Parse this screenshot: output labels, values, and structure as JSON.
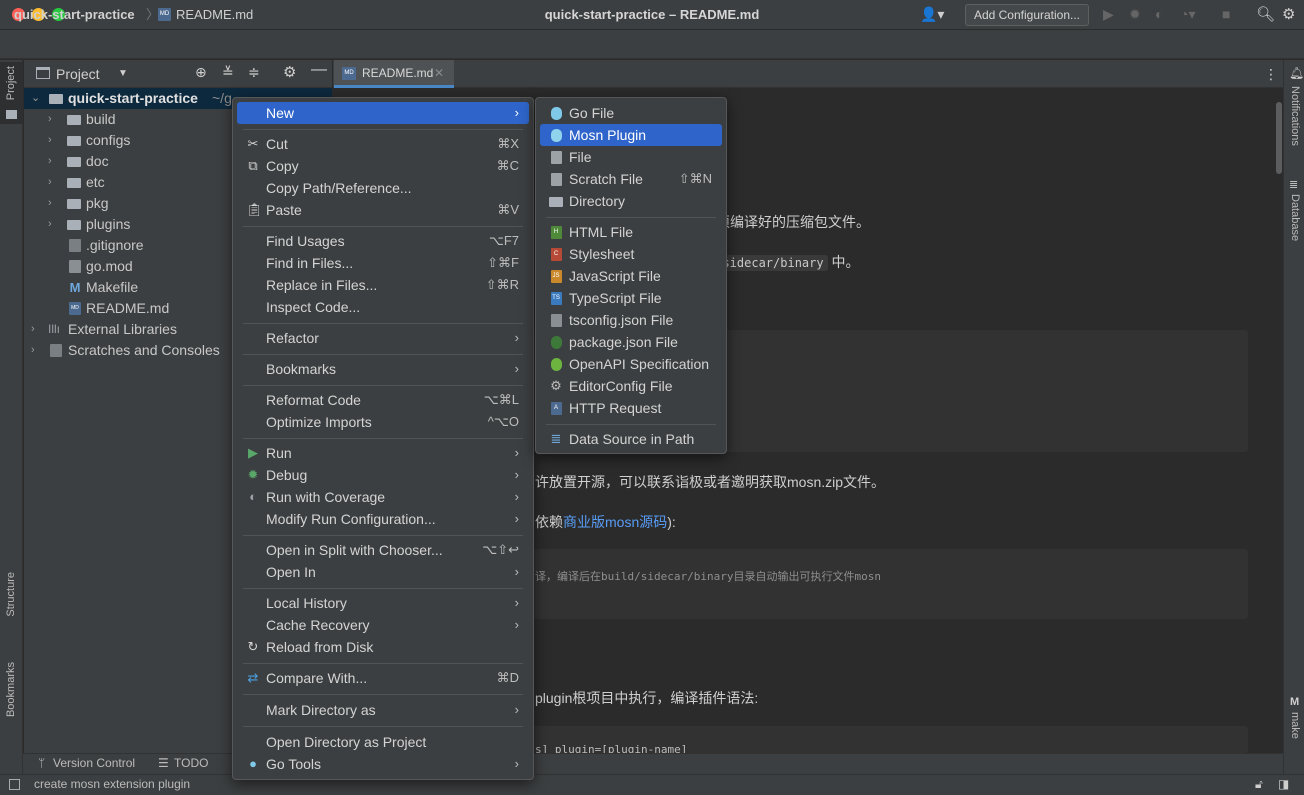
{
  "window": {
    "title": "quick-start-practice – README.md"
  },
  "navbar": {
    "project": "quick-start-practice",
    "separator": "〉",
    "file": "README.md",
    "add_configuration": "Add Configuration..."
  },
  "project_panel": {
    "title": "Project",
    "root": {
      "name": "quick-start-practice",
      "path": "~/g"
    },
    "folders": [
      "build",
      "configs",
      "doc",
      "etc",
      "pkg",
      "plugins"
    ],
    "files": [
      ".gitignore",
      "go.mod",
      "Makefile",
      "README.md"
    ],
    "external_libraries": "External Libraries",
    "scratches": "Scratches and Consoles"
  },
  "editor": {
    "tab": "README.md",
    "line1": "须编译好的压缩包文件。",
    "line2_code": "d/sidecar/binary",
    "line2_tail": " 中。",
    "line3": "许放置开源，可以联系诣极或者邀明获取mosn.zip文件。",
    "line4_pre": "依赖",
    "line4_link": "商业版mosn源码",
    "line4_post": "):",
    "code2": "译，编译后在build/sidecar/binary目录自动输出可执行文件mosn",
    "line5": "plugin根项目中执行，编译插件语法:",
    "code3": "s] plugin=[plugin-name]"
  },
  "left_strip": {
    "project": "Project",
    "structure": "Structure",
    "bookmarks": "Bookmarks"
  },
  "right_strip": {
    "notifications": "Notifications",
    "database": "Database",
    "make": "make",
    "make_icon": "M"
  },
  "context_menu": {
    "new": "New",
    "cut": "Cut",
    "cut_sc": "⌘X",
    "copy": "Copy",
    "copy_sc": "⌘C",
    "copy_path": "Copy Path/Reference...",
    "paste": "Paste",
    "paste_sc": "⌘V",
    "find_usages": "Find Usages",
    "find_usages_sc": "⌥F7",
    "find_in_files": "Find in Files...",
    "find_in_files_sc": "⇧⌘F",
    "replace_in_files": "Replace in Files...",
    "replace_in_files_sc": "⇧⌘R",
    "inspect_code": "Inspect Code...",
    "refactor": "Refactor",
    "bookmarks": "Bookmarks",
    "reformat_code": "Reformat Code",
    "reformat_code_sc": "⌥⌘L",
    "optimize_imports": "Optimize Imports",
    "optimize_imports_sc": "^⌥O",
    "run": "Run",
    "debug": "Debug",
    "run_with_coverage": "Run with Coverage",
    "modify_run_config": "Modify Run Configuration...",
    "open_in_split": "Open in Split with Chooser...",
    "open_in_split_sc": "⌥⇧↩",
    "open_in": "Open In",
    "local_history": "Local History",
    "cache_recovery": "Cache Recovery",
    "reload_from_disk": "Reload from Disk",
    "compare_with": "Compare With...",
    "compare_with_sc": "⌘D",
    "mark_directory_as": "Mark Directory as",
    "open_directory_as_project": "Open Directory as Project",
    "go_tools": "Go Tools"
  },
  "new_submenu": {
    "go_file": "Go File",
    "mosn_plugin": "Mosn Plugin",
    "file": "File",
    "scratch_file": "Scratch File",
    "scratch_file_sc": "⇧⌘N",
    "directory": "Directory",
    "html_file": "HTML File",
    "stylesheet": "Stylesheet",
    "javascript_file": "JavaScript File",
    "typescript_file": "TypeScript File",
    "tsconfig_json": "tsconfig.json File",
    "package_json": "package.json File",
    "openapi_spec": "OpenAPI Specification",
    "editorconfig_file": "EditorConfig File",
    "http_request": "HTTP Request",
    "data_source_in_path": "Data Source in Path"
  },
  "bottom_bar": {
    "version_control": "Version Control",
    "todo": "TODO"
  },
  "status_bar": {
    "message": "create mosn extension plugin"
  },
  "colors": {
    "accent": "#2f65ca",
    "background": "#2b2b2b",
    "panel": "#3c3f41",
    "link": "#589df6"
  }
}
